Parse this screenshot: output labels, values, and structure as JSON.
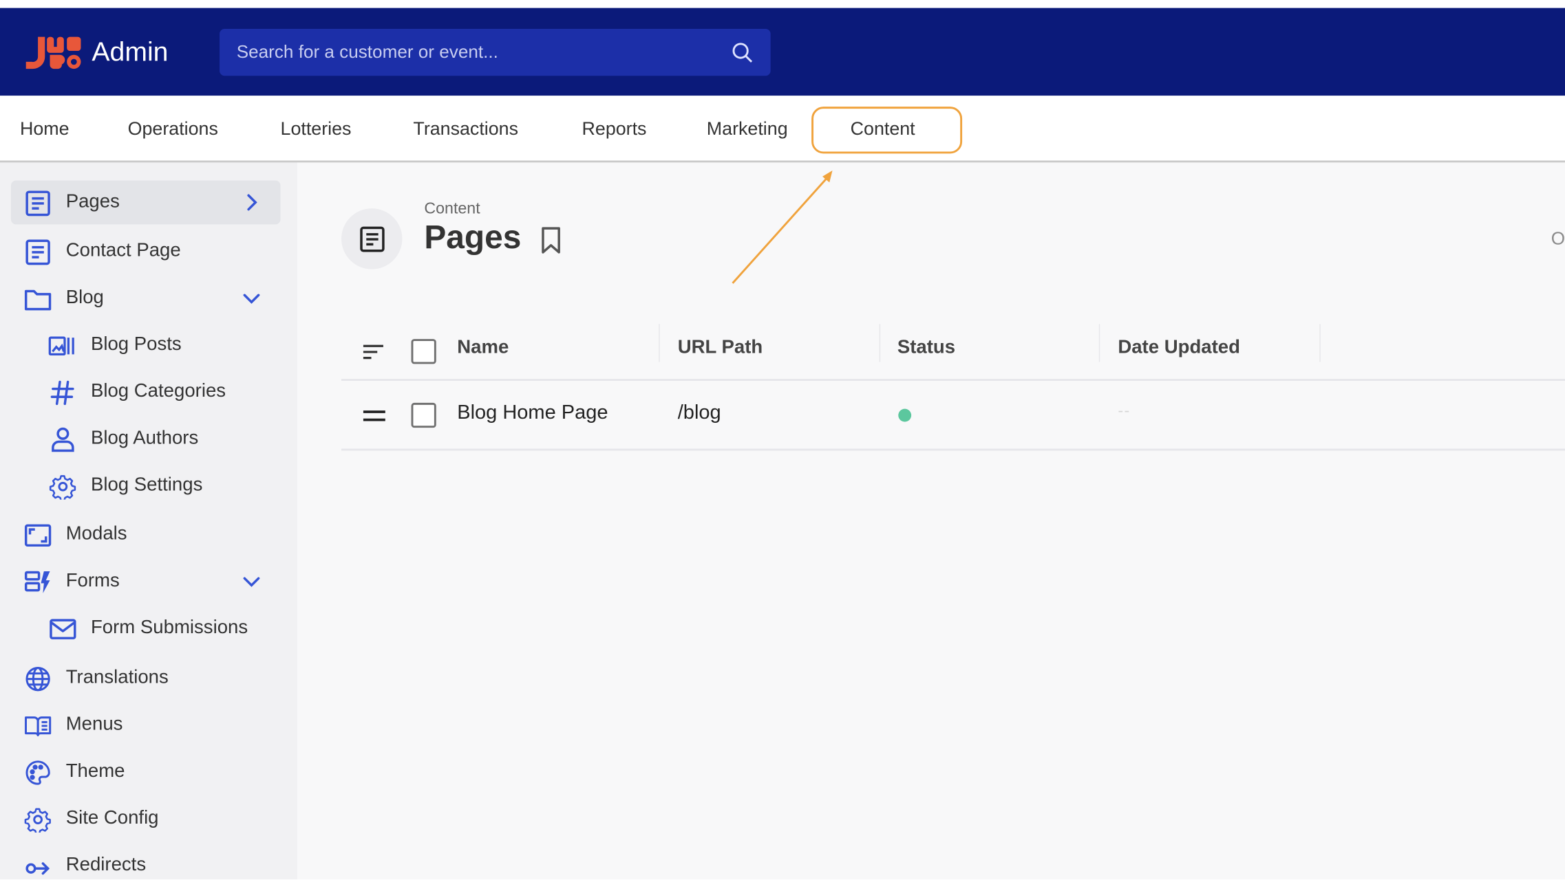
{
  "header": {
    "brand": "Admin",
    "search_placeholder": "Search for a customer or event..."
  },
  "tabs": [
    {
      "label": "Home"
    },
    {
      "label": "Operations"
    },
    {
      "label": "Lotteries"
    },
    {
      "label": "Transactions"
    },
    {
      "label": "Reports"
    },
    {
      "label": "Marketing"
    },
    {
      "label": "Content",
      "active": true
    }
  ],
  "sidebar": {
    "items": [
      {
        "label": "Pages",
        "icon": "document-icon",
        "active": true
      },
      {
        "label": "Contact Page",
        "icon": "document-icon"
      },
      {
        "label": "Blog",
        "icon": "folder-icon",
        "expanded": true
      },
      {
        "label": "Blog Posts",
        "icon": "gallery-icon"
      },
      {
        "label": "Blog Categories",
        "icon": "hash-icon"
      },
      {
        "label": "Blog Authors",
        "icon": "user-icon"
      },
      {
        "label": "Blog Settings",
        "icon": "gear-icon"
      },
      {
        "label": "Modals",
        "icon": "modal-icon"
      },
      {
        "label": "Forms",
        "icon": "form-icon",
        "expanded": true
      },
      {
        "label": "Form Submissions",
        "icon": "mail-icon"
      },
      {
        "label": "Translations",
        "icon": "globe-icon"
      },
      {
        "label": "Menus",
        "icon": "book-icon"
      },
      {
        "label": "Theme",
        "icon": "palette-icon"
      },
      {
        "label": "Site Config",
        "icon": "gear-icon"
      },
      {
        "label": "Redirects",
        "icon": "redirect-icon"
      }
    ]
  },
  "main": {
    "breadcrumb": "Content",
    "title": "Pages",
    "edge_text": "O",
    "table": {
      "columns": [
        "Name",
        "URL Path",
        "Status",
        "Date Updated"
      ],
      "rows": [
        {
          "name": "Blog Home Page",
          "url_path": "/blog",
          "status": "active",
          "date_updated": "--"
        }
      ]
    }
  },
  "colors": {
    "header_bg": "#0b1a7a",
    "search_bg": "#1c2fa8",
    "accent_icon": "#3655d6",
    "annotation": "#f0a33d",
    "status_green": "#5cc79e",
    "logo": "#e8573a"
  }
}
